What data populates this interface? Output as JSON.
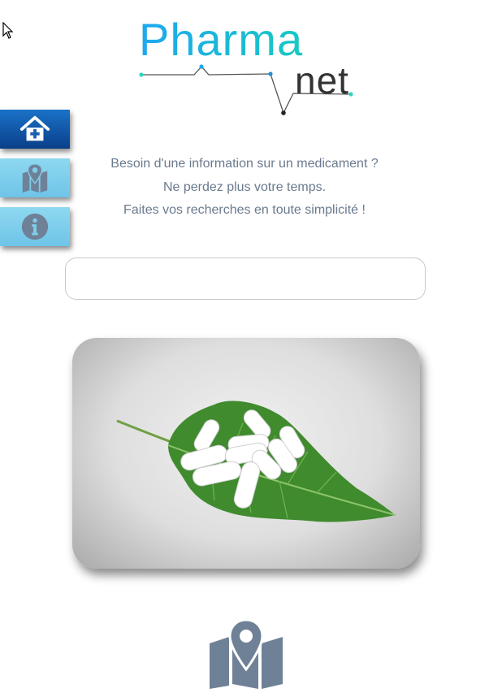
{
  "logo": {
    "part1": "Pharma",
    "part2": "net"
  },
  "side_menu": [
    {
      "icon": "home-plus-icon",
      "active": true
    },
    {
      "icon": "map-pin-icon",
      "active": false
    },
    {
      "icon": "info-icon",
      "active": false
    }
  ],
  "tagline": {
    "line1": "Besoin d'une information sur un medicament ?",
    "line2": "Ne perdez plus votre temps.",
    "line3": "Faites vos recherches en toute simplicité !"
  },
  "search": {
    "value": "",
    "placeholder": ""
  },
  "colors": {
    "accent_gradient_start": "#1ea7ef",
    "accent_gradient_end": "#17c9c2",
    "active_button": "#0a3f8a",
    "inactive_button": "#7fcdec",
    "text": "#6a7a8e",
    "icon_gray": "#6f8197"
  },
  "bottom_icon": "map-pin-icon"
}
